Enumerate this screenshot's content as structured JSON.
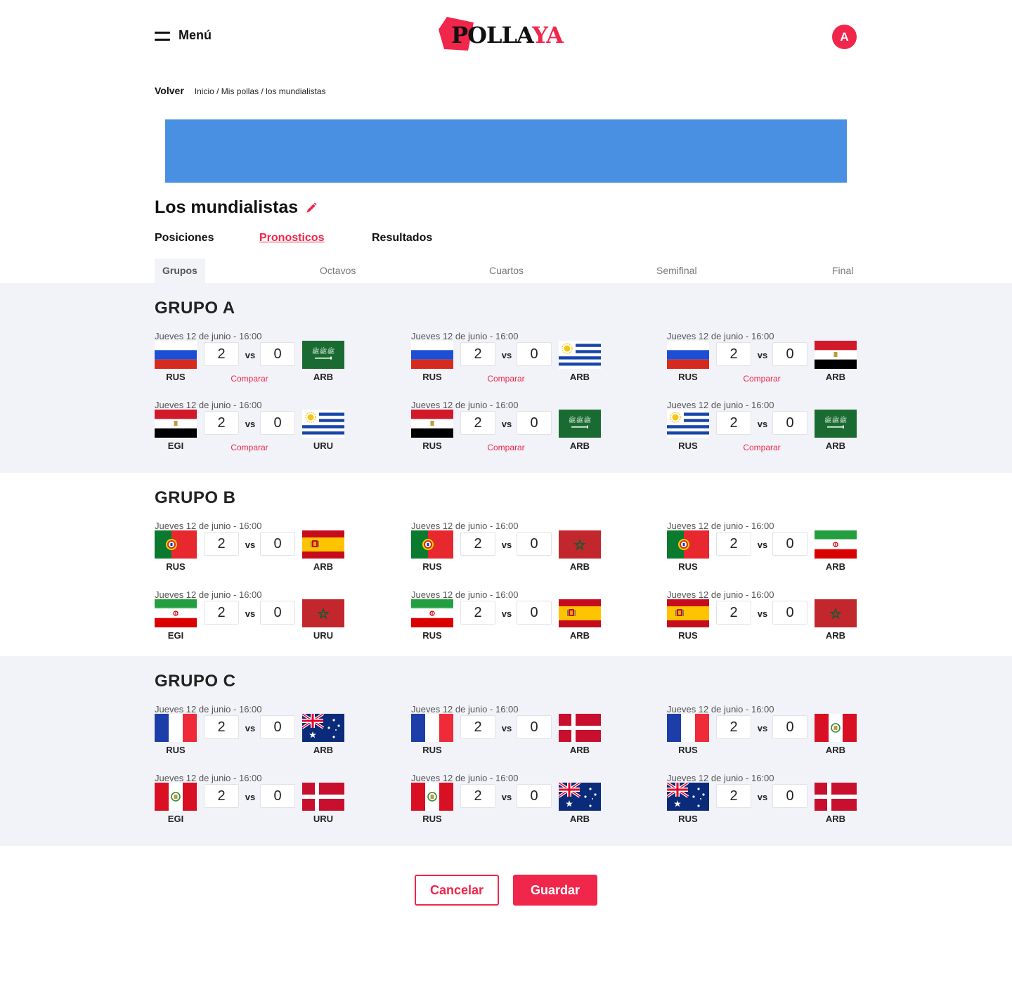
{
  "header": {
    "menu_label": "Menú",
    "logo_part1": "POLLA",
    "logo_part2": "YA",
    "avatar_initial": "A"
  },
  "breadcrumb": {
    "back_label": "Volver",
    "path": "Inicio / Mis pollas / los mundialistas"
  },
  "page": {
    "title": "Los mundialistas"
  },
  "main_tabs": [
    {
      "label": "Posiciones",
      "active": false
    },
    {
      "label": "Pronosticos",
      "active": true
    },
    {
      "label": "Resultados",
      "active": false
    }
  ],
  "stage_tabs": [
    {
      "label": "Grupos",
      "active": true
    },
    {
      "label": "Octavos",
      "active": false
    },
    {
      "label": "Cuartos",
      "active": false
    },
    {
      "label": "Semifinal",
      "active": false
    },
    {
      "label": "Final",
      "active": false
    }
  ],
  "groups": [
    {
      "title": "GRUPO A",
      "matches": [
        {
          "date": "Jueves 12 de junio - 16:00",
          "home_flag": "russia-flag",
          "home_team": "RUS",
          "home_score": "2",
          "vs": "vs",
          "away_score": "0",
          "away_flag": "saudi-arabia-flag",
          "away_team": "ARB",
          "compare": "Comparar"
        },
        {
          "date": "Jueves 12 de junio - 16:00",
          "home_flag": "russia-flag",
          "home_team": "RUS",
          "home_score": "2",
          "vs": "vs",
          "away_score": "0",
          "away_flag": "uruguay-flag",
          "away_team": "ARB",
          "compare": "Comparar"
        },
        {
          "date": "Jueves 12 de junio - 16:00",
          "home_flag": "russia-flag",
          "home_team": "RUS",
          "home_score": "2",
          "vs": "vs",
          "away_score": "0",
          "away_flag": "egypt-flag",
          "away_team": "ARB",
          "compare": "Comparar"
        },
        {
          "date": "Jueves 12 de junio - 16:00",
          "home_flag": "egypt-flag",
          "home_team": "EGI",
          "home_score": "2",
          "vs": "vs",
          "away_score": "0",
          "away_flag": "uruguay-flag",
          "away_team": "URU",
          "compare": "Comparar"
        },
        {
          "date": "Jueves 12 de junio - 16:00",
          "home_flag": "egypt-flag",
          "home_team": "RUS",
          "home_score": "2",
          "vs": "vs",
          "away_score": "0",
          "away_flag": "saudi-arabia-flag",
          "away_team": "ARB",
          "compare": "Comparar"
        },
        {
          "date": "Jueves 12 de junio - 16:00",
          "home_flag": "uruguay-flag",
          "home_team": "RUS",
          "home_score": "2",
          "vs": "vs",
          "away_score": "0",
          "away_flag": "saudi-arabia-flag",
          "away_team": "ARB",
          "compare": "Comparar"
        }
      ]
    },
    {
      "title": "GRUPO B",
      "matches": [
        {
          "date": "Jueves 12 de junio - 16:00",
          "home_flag": "portugal-flag",
          "home_team": "RUS",
          "home_score": "2",
          "vs": "vs",
          "away_score": "0",
          "away_flag": "spain-flag",
          "away_team": "ARB"
        },
        {
          "date": "Jueves 12 de junio - 16:00",
          "home_flag": "portugal-flag",
          "home_team": "RUS",
          "home_score": "2",
          "vs": "vs",
          "away_score": "0",
          "away_flag": "morocco-flag",
          "away_team": "ARB"
        },
        {
          "date": "Jueves 12 de junio - 16:00",
          "home_flag": "portugal-flag",
          "home_team": "RUS",
          "home_score": "2",
          "vs": "vs",
          "away_score": "0",
          "away_flag": "iran-flag",
          "away_team": "ARB"
        },
        {
          "date": "Jueves 12 de junio - 16:00",
          "home_flag": "iran-flag",
          "home_team": "EGI",
          "home_score": "2",
          "vs": "vs",
          "away_score": "0",
          "away_flag": "morocco-flag",
          "away_team": "URU"
        },
        {
          "date": "Jueves 12 de junio - 16:00",
          "home_flag": "iran-flag",
          "home_team": "RUS",
          "home_score": "2",
          "vs": "vs",
          "away_score": "0",
          "away_flag": "spain-flag",
          "away_team": "ARB"
        },
        {
          "date": "Jueves 12 de junio - 16:00",
          "home_flag": "spain-flag",
          "home_team": "RUS",
          "home_score": "2",
          "vs": "vs",
          "away_score": "0",
          "away_flag": "morocco-flag",
          "away_team": "ARB"
        }
      ]
    },
    {
      "title": "GRUPO C",
      "matches": [
        {
          "date": "Jueves 12 de junio - 16:00",
          "home_flag": "france-flag",
          "home_team": "RUS",
          "home_score": "2",
          "vs": "vs",
          "away_score": "0",
          "away_flag": "australia-flag",
          "away_team": "ARB"
        },
        {
          "date": "Jueves 12 de junio - 16:00",
          "home_flag": "france-flag",
          "home_team": "RUS",
          "home_score": "2",
          "vs": "vs",
          "away_score": "0",
          "away_flag": "denmark-flag",
          "away_team": "ARB"
        },
        {
          "date": "Jueves 12 de junio - 16:00",
          "home_flag": "france-flag",
          "home_team": "RUS",
          "home_score": "2",
          "vs": "vs",
          "away_score": "0",
          "away_flag": "peru-flag",
          "away_team": "ARB"
        },
        {
          "date": "Jueves 12 de junio - 16:00",
          "home_flag": "peru-flag",
          "home_team": "EGI",
          "home_score": "2",
          "vs": "vs",
          "away_score": "0",
          "away_flag": "denmark-flag",
          "away_team": "URU"
        },
        {
          "date": "Jueves 12 de junio - 16:00",
          "home_flag": "peru-flag",
          "home_team": "RUS",
          "home_score": "2",
          "vs": "vs",
          "away_score": "0",
          "away_flag": "australia-flag",
          "away_team": "ARB"
        },
        {
          "date": "Jueves 12 de junio - 16:00",
          "home_flag": "australia-flag",
          "home_team": "RUS",
          "home_score": "2",
          "vs": "vs",
          "away_score": "0",
          "away_flag": "denmark-flag",
          "away_team": "ARB"
        }
      ]
    }
  ],
  "actions": {
    "cancel_label": "Cancelar",
    "save_label": "Guardar"
  },
  "colors": {
    "accent": "#f0264a",
    "banner": "#4a90e2",
    "group_background": "#f2f3f8"
  }
}
